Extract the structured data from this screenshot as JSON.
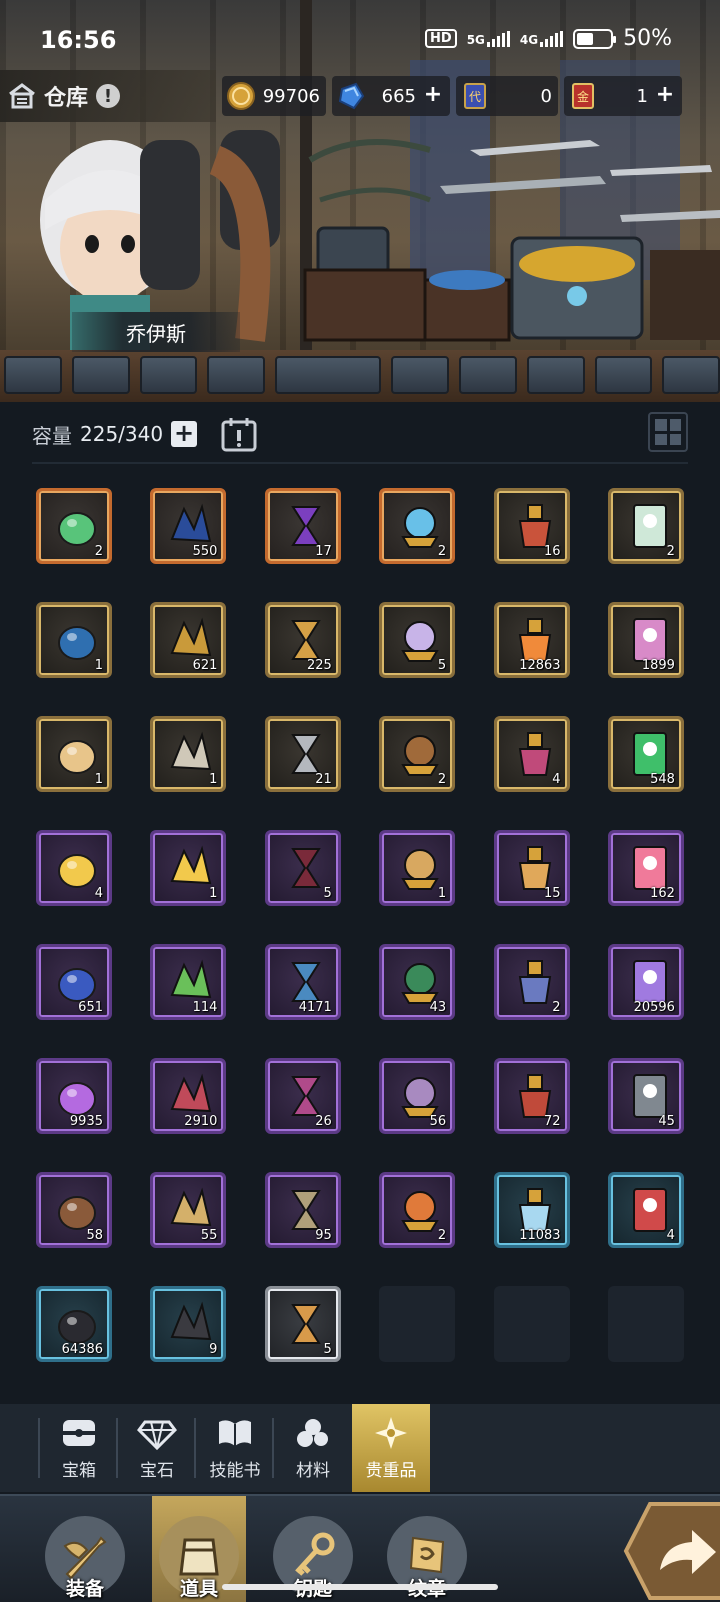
{
  "status_bar": {
    "time": "16:56",
    "hd_badge": "HD",
    "net1": "5G",
    "net2": "4G",
    "battery": "50%",
    "battery_level": 0.5
  },
  "header": {
    "title": "仓库",
    "info_badge": "!",
    "currencies": [
      {
        "icon": "gold-coin-icon",
        "value": "99706",
        "has_plus": false
      },
      {
        "icon": "blue-gem-icon",
        "value": "665",
        "has_plus": true
      },
      {
        "icon": "blue-ticket-icon",
        "value": "0",
        "has_plus": false
      },
      {
        "icon": "gold-ticket-icon",
        "value": "1",
        "has_plus": true
      }
    ],
    "ticket1_glyph": "代",
    "ticket2_glyph": "金"
  },
  "npc": {
    "name": "乔伊斯"
  },
  "capacity": {
    "label": "容量",
    "value": "225/340"
  },
  "items": [
    {
      "name": "green-potion-item",
      "rarity": "orange",
      "qty": "2"
    },
    {
      "name": "dark-crystal-item",
      "rarity": "orange",
      "qty": "550"
    },
    {
      "name": "purple-hourglass-item",
      "rarity": "orange",
      "qty": "17"
    },
    {
      "name": "crystal-orb-item",
      "rarity": "orange",
      "qty": "2"
    },
    {
      "name": "red-flask-item",
      "rarity": "gold",
      "qty": "16"
    },
    {
      "name": "cat-card-item",
      "rarity": "gold",
      "qty": "2"
    },
    {
      "name": "monster-portrait-item",
      "rarity": "gold",
      "qty": "1"
    },
    {
      "name": "red-shield-item",
      "rarity": "gold",
      "qty": "621"
    },
    {
      "name": "golden-key-item",
      "rarity": "gold",
      "qty": "225"
    },
    {
      "name": "star-shard-item",
      "rarity": "gold",
      "qty": "5"
    },
    {
      "name": "orange-crystal-item",
      "rarity": "gold",
      "qty": "12863"
    },
    {
      "name": "pink-bear-item",
      "rarity": "gold",
      "qty": "1899"
    },
    {
      "name": "paper-scrap-item",
      "rarity": "gold",
      "qty": "1"
    },
    {
      "name": "thread-spool-item",
      "rarity": "gold",
      "qty": "1"
    },
    {
      "name": "iron-ingot-item",
      "rarity": "gold",
      "qty": "21"
    },
    {
      "name": "brown-envelope-item",
      "rarity": "gold",
      "qty": "2"
    },
    {
      "name": "gem-cluster-item",
      "rarity": "gold",
      "qty": "4"
    },
    {
      "name": "green-bottle-item",
      "rarity": "gold",
      "qty": "548"
    },
    {
      "name": "cheese-wedge-item",
      "rarity": "purple",
      "qty": "4"
    },
    {
      "name": "blue-cheese-item",
      "rarity": "purple",
      "qty": "1"
    },
    {
      "name": "wine-bottle-item",
      "rarity": "purple",
      "qty": "5"
    },
    {
      "name": "whiskey-bottle-item",
      "rarity": "purple",
      "qty": "1"
    },
    {
      "name": "toast-bread-item",
      "rarity": "purple",
      "qty": "15"
    },
    {
      "name": "cupcake-item",
      "rarity": "purple",
      "qty": "162"
    },
    {
      "name": "blue-scroll-item",
      "rarity": "purple",
      "qty": "651"
    },
    {
      "name": "green-scroll-item",
      "rarity": "purple",
      "qty": "114"
    },
    {
      "name": "blue-map-item",
      "rarity": "purple",
      "qty": "4171"
    },
    {
      "name": "soup-pot-item",
      "rarity": "purple",
      "qty": "43"
    },
    {
      "name": "stone-ring-item",
      "rarity": "purple",
      "qty": "2"
    },
    {
      "name": "purple-claw-item",
      "rarity": "purple",
      "qty": "20596"
    },
    {
      "name": "amethyst-item",
      "rarity": "purple",
      "qty": "9935"
    },
    {
      "name": "gem-badge-item",
      "rarity": "purple",
      "qty": "2910"
    },
    {
      "name": "pink-cloth-item",
      "rarity": "purple",
      "qty": "26"
    },
    {
      "name": "bandage-roll-item",
      "rarity": "purple",
      "qty": "56"
    },
    {
      "name": "red-ribbon-item",
      "rarity": "purple",
      "qty": "72"
    },
    {
      "name": "grey-ore-item",
      "rarity": "purple",
      "qty": "45"
    },
    {
      "name": "leather-envelope-item",
      "rarity": "purple",
      "qty": "58"
    },
    {
      "name": "gold-block-item",
      "rarity": "purple",
      "qty": "55"
    },
    {
      "name": "metal-cube-item",
      "rarity": "purple",
      "qty": "95"
    },
    {
      "name": "fire-spirit-item",
      "rarity": "purple",
      "qty": "2"
    },
    {
      "name": "ice-crystal-item",
      "rarity": "blue",
      "qty": "11083"
    },
    {
      "name": "red-cloth-item",
      "rarity": "blue",
      "qty": "4"
    },
    {
      "name": "lava-rock-item",
      "rarity": "blue",
      "qty": "64386"
    },
    {
      "name": "coal-sparkle-item",
      "rarity": "blue",
      "qty": "9"
    },
    {
      "name": "cookie-item",
      "rarity": "white",
      "qty": "5"
    },
    {
      "name": "empty-slot",
      "rarity": "empty",
      "qty": ""
    },
    {
      "name": "empty-slot",
      "rarity": "empty",
      "qty": ""
    },
    {
      "name": "empty-slot",
      "rarity": "empty",
      "qty": ""
    }
  ],
  "categories": [
    {
      "label": "宝箱",
      "icon": "chest-icon",
      "active": false
    },
    {
      "label": "宝石",
      "icon": "gem-icon",
      "active": false
    },
    {
      "label": "技能书",
      "icon": "book-icon",
      "active": false
    },
    {
      "label": "材料",
      "icon": "material-icon",
      "active": false
    },
    {
      "label": "贵重品",
      "icon": "star-compass-icon",
      "active": true
    }
  ],
  "bottom_nav": [
    {
      "label": "装备",
      "icon": "equipment-icon",
      "active": false
    },
    {
      "label": "道具",
      "icon": "bag-icon",
      "active": true
    },
    {
      "label": "钥匙",
      "icon": "key-icon",
      "active": false
    },
    {
      "label": "纹章",
      "icon": "crest-icon",
      "active": false
    }
  ],
  "colors": {
    "rarity_orange": "#c46a2e",
    "rarity_gold": "#d9b86a",
    "rarity_purple": "#a271d8",
    "rarity_blue": "#69c2e0",
    "rarity_white": "#e6e9ee",
    "active_tab": "#d4b552"
  }
}
